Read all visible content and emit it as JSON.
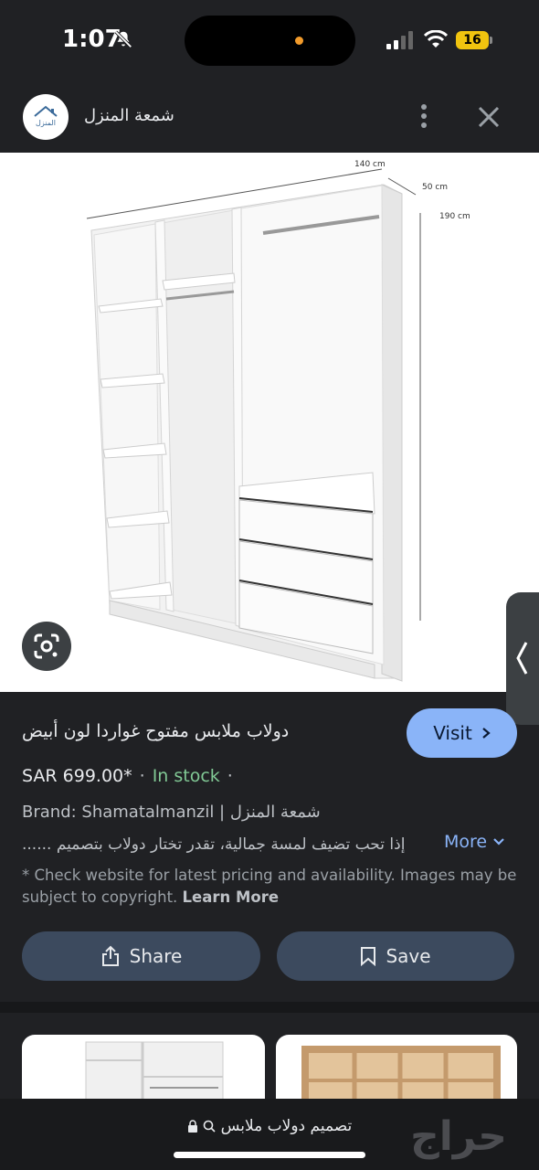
{
  "status_bar": {
    "time": "1:07",
    "battery": "16"
  },
  "header": {
    "site_name": "شمعة المنزل",
    "logo_text": "المنزل"
  },
  "image": {
    "dim_width": "140 cm",
    "dim_depth": "50 cm",
    "dim_height": "190 cm"
  },
  "product": {
    "title": "دولاب ملابس مفتوح غواردا لون أبيض",
    "visit_label": "Visit",
    "price": "SAR 699.00*",
    "separator": "·",
    "stock": "In stock",
    "brand": "Brand: Shamatalmanzil | شمعة المنزل",
    "description": "...... إذا تحب تضيف لمسة جمالية، تقدر تختار دولاب بتصميم",
    "more_label": "More",
    "disclaimer": "* Check website for latest pricing and availability. Images may be subject to copyright.",
    "learn_more": "Learn More"
  },
  "actions": {
    "share_label": "Share",
    "save_label": "Save"
  },
  "bottom_bar": {
    "url": "تصميم دولاب ملابس",
    "brand": "حراج"
  },
  "colors": {
    "accent": "#8ab4f8",
    "in_stock": "#81c995",
    "background": "#202124"
  }
}
